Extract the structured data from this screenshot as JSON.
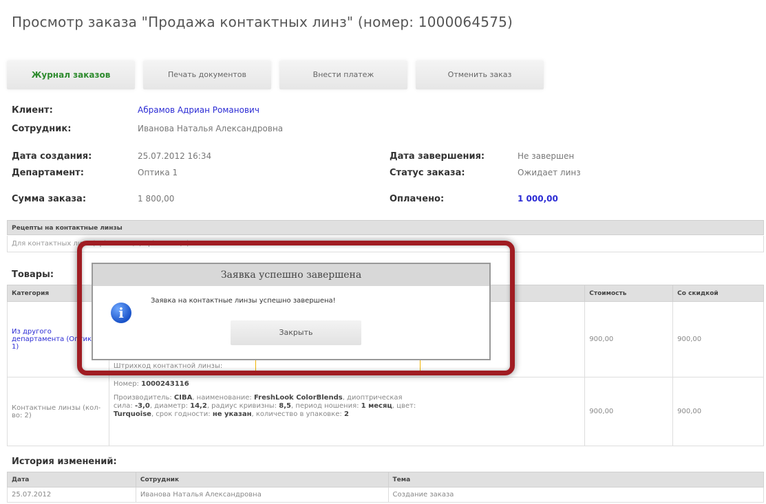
{
  "page_title": "Просмотр заказа \"Продажа контактных линз\" (номер: 1000064575)",
  "toolbar": [
    {
      "label": "Журнал заказов"
    },
    {
      "label": "Печать документов"
    },
    {
      "label": "Внести платеж"
    },
    {
      "label": "Отменить заказ"
    }
  ],
  "info": {
    "client_label": "Клиент:",
    "client_value": "Абрамов Адриан Романович",
    "employee_label": "Сотрудник:",
    "employee_value": "Иванова Наталья Александровна",
    "created_label": "Дата создания:",
    "created_value": "25.07.2012 16:34",
    "department_label": "Департамент:",
    "department_value": "Оптика 1",
    "sum_label": "Сумма заказа:",
    "sum_value": "1 800,00",
    "finished_label": "Дата завершения:",
    "finished_value": "Не завершен",
    "status_label": "Статус заказа:",
    "status_value": "Ожидает линз",
    "paid_label": "Оплачено:",
    "paid_value": "1 000,00"
  },
  "recipes": {
    "header": "Рецепты на контактные линзы",
    "row": "Для контактных линз (Sph OD: -2,0; Sph OS: -1,0)"
  },
  "goods": {
    "title": "Товары:",
    "columns": [
      "Категория",
      "Стоимость",
      "Со скидкой"
    ],
    "row1": {
      "category": "Из другого департамента (Оптика 1)",
      "barcode_label": "Штрихкод контактной линзы:",
      "cost": "900,00",
      "discount": "900,00"
    },
    "row2": {
      "category": "Контактные линзы (кол-во: 2)",
      "number_label": "Номер:",
      "number_value": "1000243116",
      "desc_1": "Производитель: ",
      "manufacturer": "CIBA",
      "desc_2": ", наименование: ",
      "name": "FreshLook ColorBlends",
      "desc_3": ", диоптрическая сила: ",
      "power": "-3,0",
      "desc_4": ", диаметр: ",
      "diameter": "14,2",
      "desc_5": ", радиус кривизны: ",
      "radius": "8,5",
      "desc_6": ", период ношения: ",
      "period": "1 месяц",
      "desc_7": ", цвет: ",
      "color": "Turquoise",
      "desc_8": ", срок годности: ",
      "expiry": "не указан",
      "desc_9": ", количество в упаковке: ",
      "pack": "2",
      "cost": "900,00",
      "discount": "900,00"
    }
  },
  "history": {
    "title": "История изменений:",
    "columns": [
      "Дата",
      "Сотрудник",
      "Тема"
    ],
    "rows": [
      {
        "date": "25.07.2012",
        "employee": "Иванова Наталья Александровна",
        "topic": "Создание заказа"
      }
    ]
  },
  "dialog": {
    "title": "Заявка успешно завершена",
    "message": "Заявка на контактные линзы успешно завершена!",
    "close_label": "Закрыть"
  },
  "colors": {
    "link": "#2b2bd4",
    "active_tab": "#2e8b2e",
    "highlight_ring": "#a01c22"
  }
}
